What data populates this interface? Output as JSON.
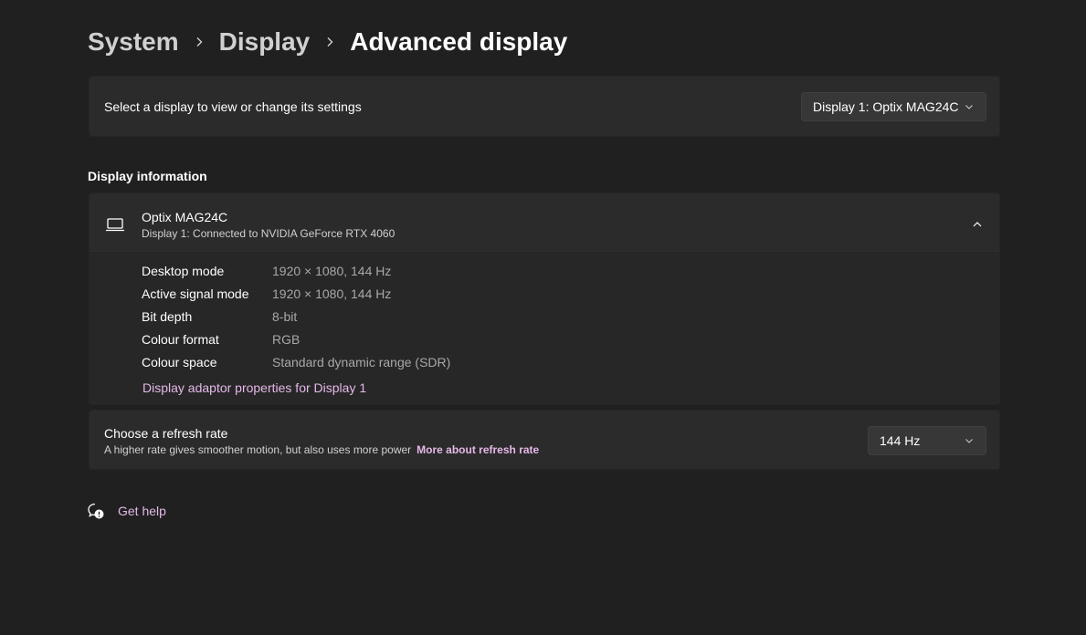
{
  "breadcrumb": {
    "items": [
      "System",
      "Display"
    ],
    "current": "Advanced display"
  },
  "display_select": {
    "label": "Select a display to view or change its settings",
    "selected": "Display 1: Optix MAG24C"
  },
  "display_info": {
    "section_title": "Display information",
    "monitor_name": "Optix MAG24C",
    "connection": "Display 1: Connected to NVIDIA GeForce RTX 4060",
    "rows": [
      {
        "label": "Desktop mode",
        "value": "1920 × 1080, 144 Hz"
      },
      {
        "label": "Active signal mode",
        "value": "1920 × 1080, 144 Hz"
      },
      {
        "label": "Bit depth",
        "value": "8-bit"
      },
      {
        "label": "Colour format",
        "value": "RGB"
      },
      {
        "label": "Colour space",
        "value": "Standard dynamic range (SDR)"
      }
    ],
    "adapter_link": "Display adaptor properties for Display 1"
  },
  "refresh_rate": {
    "title": "Choose a refresh rate",
    "description": "A higher rate gives smoother motion, but also uses more power",
    "more_link": "More about refresh rate",
    "selected": "144 Hz"
  },
  "help": {
    "label": "Get help"
  },
  "colors": {
    "background": "#202020",
    "card": "#2b2b2b",
    "accent_link": "#e5b8e8"
  }
}
